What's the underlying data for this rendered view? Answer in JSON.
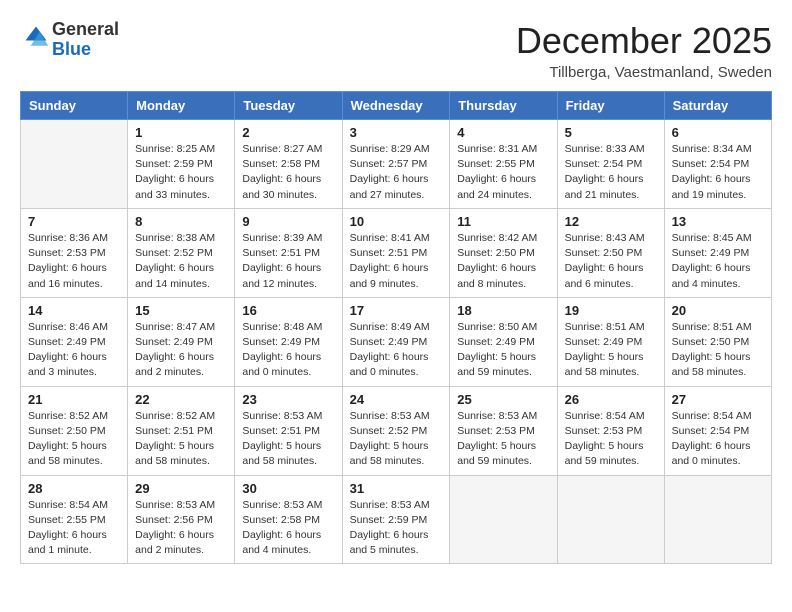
{
  "header": {
    "logo": {
      "general": "General",
      "blue": "Blue"
    },
    "title": "December 2025",
    "location": "Tillberga, Vaestmanland, Sweden"
  },
  "weekdays": [
    "Sunday",
    "Monday",
    "Tuesday",
    "Wednesday",
    "Thursday",
    "Friday",
    "Saturday"
  ],
  "weeks": [
    [
      {
        "day": "",
        "info": ""
      },
      {
        "day": "1",
        "info": "Sunrise: 8:25 AM\nSunset: 2:59 PM\nDaylight: 6 hours\nand 33 minutes."
      },
      {
        "day": "2",
        "info": "Sunrise: 8:27 AM\nSunset: 2:58 PM\nDaylight: 6 hours\nand 30 minutes."
      },
      {
        "day": "3",
        "info": "Sunrise: 8:29 AM\nSunset: 2:57 PM\nDaylight: 6 hours\nand 27 minutes."
      },
      {
        "day": "4",
        "info": "Sunrise: 8:31 AM\nSunset: 2:55 PM\nDaylight: 6 hours\nand 24 minutes."
      },
      {
        "day": "5",
        "info": "Sunrise: 8:33 AM\nSunset: 2:54 PM\nDaylight: 6 hours\nand 21 minutes."
      },
      {
        "day": "6",
        "info": "Sunrise: 8:34 AM\nSunset: 2:54 PM\nDaylight: 6 hours\nand 19 minutes."
      }
    ],
    [
      {
        "day": "7",
        "info": "Sunrise: 8:36 AM\nSunset: 2:53 PM\nDaylight: 6 hours\nand 16 minutes."
      },
      {
        "day": "8",
        "info": "Sunrise: 8:38 AM\nSunset: 2:52 PM\nDaylight: 6 hours\nand 14 minutes."
      },
      {
        "day": "9",
        "info": "Sunrise: 8:39 AM\nSunset: 2:51 PM\nDaylight: 6 hours\nand 12 minutes."
      },
      {
        "day": "10",
        "info": "Sunrise: 8:41 AM\nSunset: 2:51 PM\nDaylight: 6 hours\nand 9 minutes."
      },
      {
        "day": "11",
        "info": "Sunrise: 8:42 AM\nSunset: 2:50 PM\nDaylight: 6 hours\nand 8 minutes."
      },
      {
        "day": "12",
        "info": "Sunrise: 8:43 AM\nSunset: 2:50 PM\nDaylight: 6 hours\nand 6 minutes."
      },
      {
        "day": "13",
        "info": "Sunrise: 8:45 AM\nSunset: 2:49 PM\nDaylight: 6 hours\nand 4 minutes."
      }
    ],
    [
      {
        "day": "14",
        "info": "Sunrise: 8:46 AM\nSunset: 2:49 PM\nDaylight: 6 hours\nand 3 minutes."
      },
      {
        "day": "15",
        "info": "Sunrise: 8:47 AM\nSunset: 2:49 PM\nDaylight: 6 hours\nand 2 minutes."
      },
      {
        "day": "16",
        "info": "Sunrise: 8:48 AM\nSunset: 2:49 PM\nDaylight: 6 hours\nand 0 minutes."
      },
      {
        "day": "17",
        "info": "Sunrise: 8:49 AM\nSunset: 2:49 PM\nDaylight: 6 hours\nand 0 minutes."
      },
      {
        "day": "18",
        "info": "Sunrise: 8:50 AM\nSunset: 2:49 PM\nDaylight: 5 hours\nand 59 minutes."
      },
      {
        "day": "19",
        "info": "Sunrise: 8:51 AM\nSunset: 2:49 PM\nDaylight: 5 hours\nand 58 minutes."
      },
      {
        "day": "20",
        "info": "Sunrise: 8:51 AM\nSunset: 2:50 PM\nDaylight: 5 hours\nand 58 minutes."
      }
    ],
    [
      {
        "day": "21",
        "info": "Sunrise: 8:52 AM\nSunset: 2:50 PM\nDaylight: 5 hours\nand 58 minutes."
      },
      {
        "day": "22",
        "info": "Sunrise: 8:52 AM\nSunset: 2:51 PM\nDaylight: 5 hours\nand 58 minutes."
      },
      {
        "day": "23",
        "info": "Sunrise: 8:53 AM\nSunset: 2:51 PM\nDaylight: 5 hours\nand 58 minutes."
      },
      {
        "day": "24",
        "info": "Sunrise: 8:53 AM\nSunset: 2:52 PM\nDaylight: 5 hours\nand 58 minutes."
      },
      {
        "day": "25",
        "info": "Sunrise: 8:53 AM\nSunset: 2:53 PM\nDaylight: 5 hours\nand 59 minutes."
      },
      {
        "day": "26",
        "info": "Sunrise: 8:54 AM\nSunset: 2:53 PM\nDaylight: 5 hours\nand 59 minutes."
      },
      {
        "day": "27",
        "info": "Sunrise: 8:54 AM\nSunset: 2:54 PM\nDaylight: 6 hours\nand 0 minutes."
      }
    ],
    [
      {
        "day": "28",
        "info": "Sunrise: 8:54 AM\nSunset: 2:55 PM\nDaylight: 6 hours\nand 1 minute."
      },
      {
        "day": "29",
        "info": "Sunrise: 8:53 AM\nSunset: 2:56 PM\nDaylight: 6 hours\nand 2 minutes."
      },
      {
        "day": "30",
        "info": "Sunrise: 8:53 AM\nSunset: 2:58 PM\nDaylight: 6 hours\nand 4 minutes."
      },
      {
        "day": "31",
        "info": "Sunrise: 8:53 AM\nSunset: 2:59 PM\nDaylight: 6 hours\nand 5 minutes."
      },
      {
        "day": "",
        "info": ""
      },
      {
        "day": "",
        "info": ""
      },
      {
        "day": "",
        "info": ""
      }
    ]
  ]
}
